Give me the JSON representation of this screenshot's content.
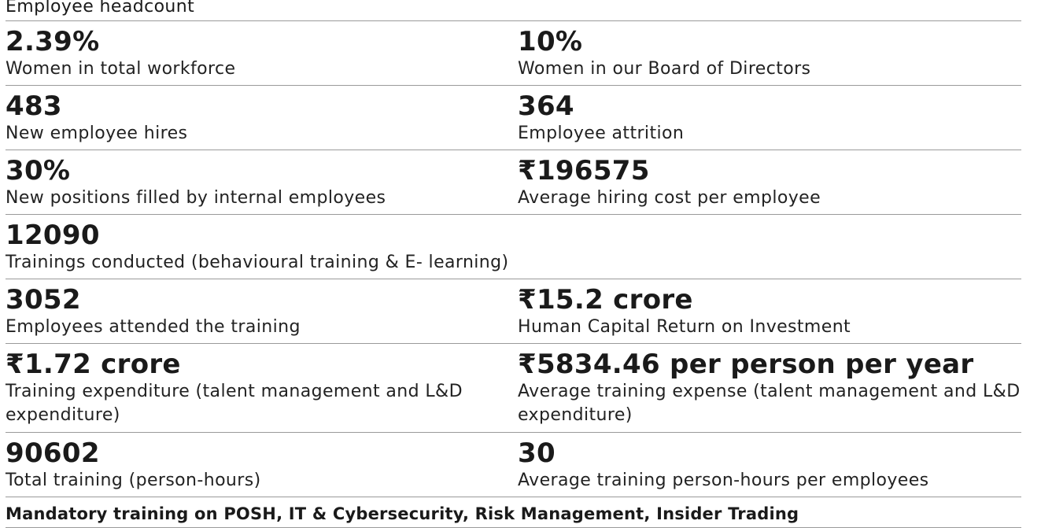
{
  "header": {
    "label": "Employee headcount"
  },
  "rows": [
    {
      "left": {
        "value": "2.39%",
        "label": "Women in total workforce"
      },
      "right": {
        "value": "10%",
        "label": "Women in our Board of Directors"
      }
    },
    {
      "left": {
        "value": "483",
        "label": "New employee hires"
      },
      "right": {
        "value": "364",
        "label": "Employee attrition"
      }
    },
    {
      "left": {
        "value": "30%",
        "label": "New positions filled by internal employees"
      },
      "right": {
        "value": "₹196575",
        "label": "Average hiring cost per employee"
      }
    },
    {
      "full": {
        "value": "12090",
        "label": "Trainings conducted (behavioural training & E- learning)"
      }
    },
    {
      "left": {
        "value": "3052",
        "label": "Employees attended the training"
      },
      "right": {
        "value": "₹15.2 crore",
        "label": "Human Capital Return on Investment"
      }
    },
    {
      "left": {
        "value": "₹1.72 crore",
        "label": "Training expenditure (talent management and L&D expenditure)"
      },
      "right": {
        "value": "₹5834.46 per person per year",
        "label": "Average training expense (talent management and L&D expenditure)"
      }
    },
    {
      "left": {
        "value": "90602",
        "label": "Total training (person-hours)"
      },
      "right": {
        "value": "30",
        "label": "Average training person-hours per employees"
      }
    }
  ],
  "footer": {
    "text": "Mandatory training on POSH, IT & Cybersecurity, Risk Management, Insider Trading"
  }
}
